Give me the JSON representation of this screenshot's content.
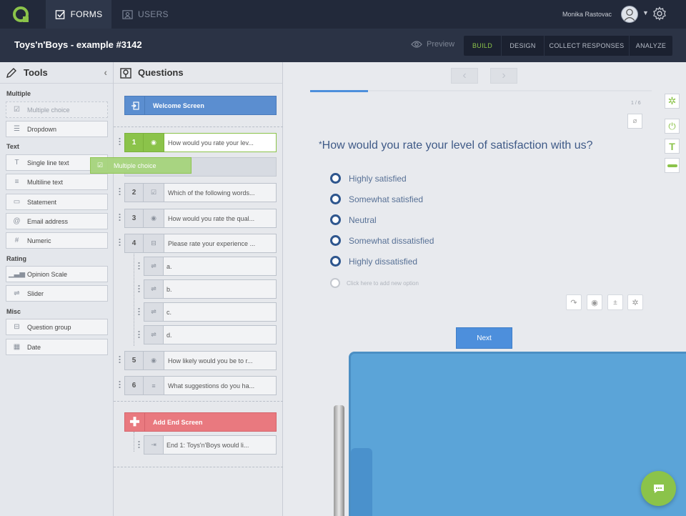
{
  "topnav": {
    "tabs": [
      {
        "label": "FORMS"
      },
      {
        "label": "USERS"
      }
    ],
    "user_name": "Monika Rastovac"
  },
  "header": {
    "form_title": "Toys'n'Boys - example #3142",
    "preview_label": "Preview",
    "modes": [
      {
        "label": "BUILD"
      },
      {
        "label": "DESIGN"
      },
      {
        "label": "COLLECT RESPONSES"
      },
      {
        "label": "ANALYZE"
      }
    ],
    "active_mode": "BUILD"
  },
  "tools": {
    "title": "Tools",
    "sections": [
      {
        "title": "Multiple",
        "items": [
          {
            "label": "Multiple choice",
            "icon": "checkbox-icon",
            "disabled": true
          },
          {
            "label": "Dropdown",
            "icon": "list-icon"
          }
        ]
      },
      {
        "title": "Text",
        "items": [
          {
            "label": "Single line text",
            "icon": "text-icon"
          },
          {
            "label": "Multiline text",
            "icon": "lines-icon"
          },
          {
            "label": "Statement",
            "icon": "comment-icon"
          },
          {
            "label": "Email address",
            "icon": "at-icon"
          },
          {
            "label": "Numeric",
            "icon": "hash-icon"
          }
        ]
      },
      {
        "title": "Rating",
        "items": [
          {
            "label": "Opinion Scale",
            "icon": "bar-chart-icon"
          },
          {
            "label": "Slider",
            "icon": "slider-icon"
          }
        ]
      },
      {
        "title": "Misc",
        "items": [
          {
            "label": "Question group",
            "icon": "group-icon"
          },
          {
            "label": "Date",
            "icon": "calendar-icon"
          }
        ]
      }
    ],
    "drag_ghost_label": "Multiple choice"
  },
  "questions": {
    "title": "Questions",
    "welcome_label": "Welcome Screen",
    "items": [
      {
        "num": "1",
        "text": "How would you rate your lev...",
        "icon": "radio-icon",
        "active": true
      },
      {
        "num": "2",
        "text": "Which of the following words...",
        "icon": "checkbox-icon"
      },
      {
        "num": "3",
        "text": "How would you rate the qual...",
        "icon": "radio-icon"
      },
      {
        "num": "4",
        "text": "Please rate your experience ...",
        "icon": "group-icon"
      },
      {
        "num": "5",
        "text": "How likely would you be to r...",
        "icon": "radio-icon"
      },
      {
        "num": "6",
        "text": "What suggestions do you ha...",
        "icon": "lines-icon"
      }
    ],
    "subitems": [
      {
        "text": "a."
      },
      {
        "text": "b."
      },
      {
        "text": "c."
      },
      {
        "text": "d."
      }
    ],
    "add_end_label": "Add End Screen",
    "end_screen_text": "End 1: Toys'n'Boys would li..."
  },
  "preview_pane": {
    "page_counter": "1 / 6",
    "progress": 0.17,
    "required_mark": "*",
    "question_title": "How would you rate your level of satisfaction with us?",
    "options": [
      "Highly satisfied",
      "Somewhat satisfied",
      "Neutral",
      "Somewhat dissatisfied",
      "Highly dissatisfied"
    ],
    "add_option_hint": "Click here to add new option",
    "next_label": "Next"
  },
  "colors": {
    "accent_green": "#8bc34a",
    "accent_blue": "#4d8fdc",
    "end_screen_red": "#e9797f",
    "nav_dark": "#22293a"
  }
}
